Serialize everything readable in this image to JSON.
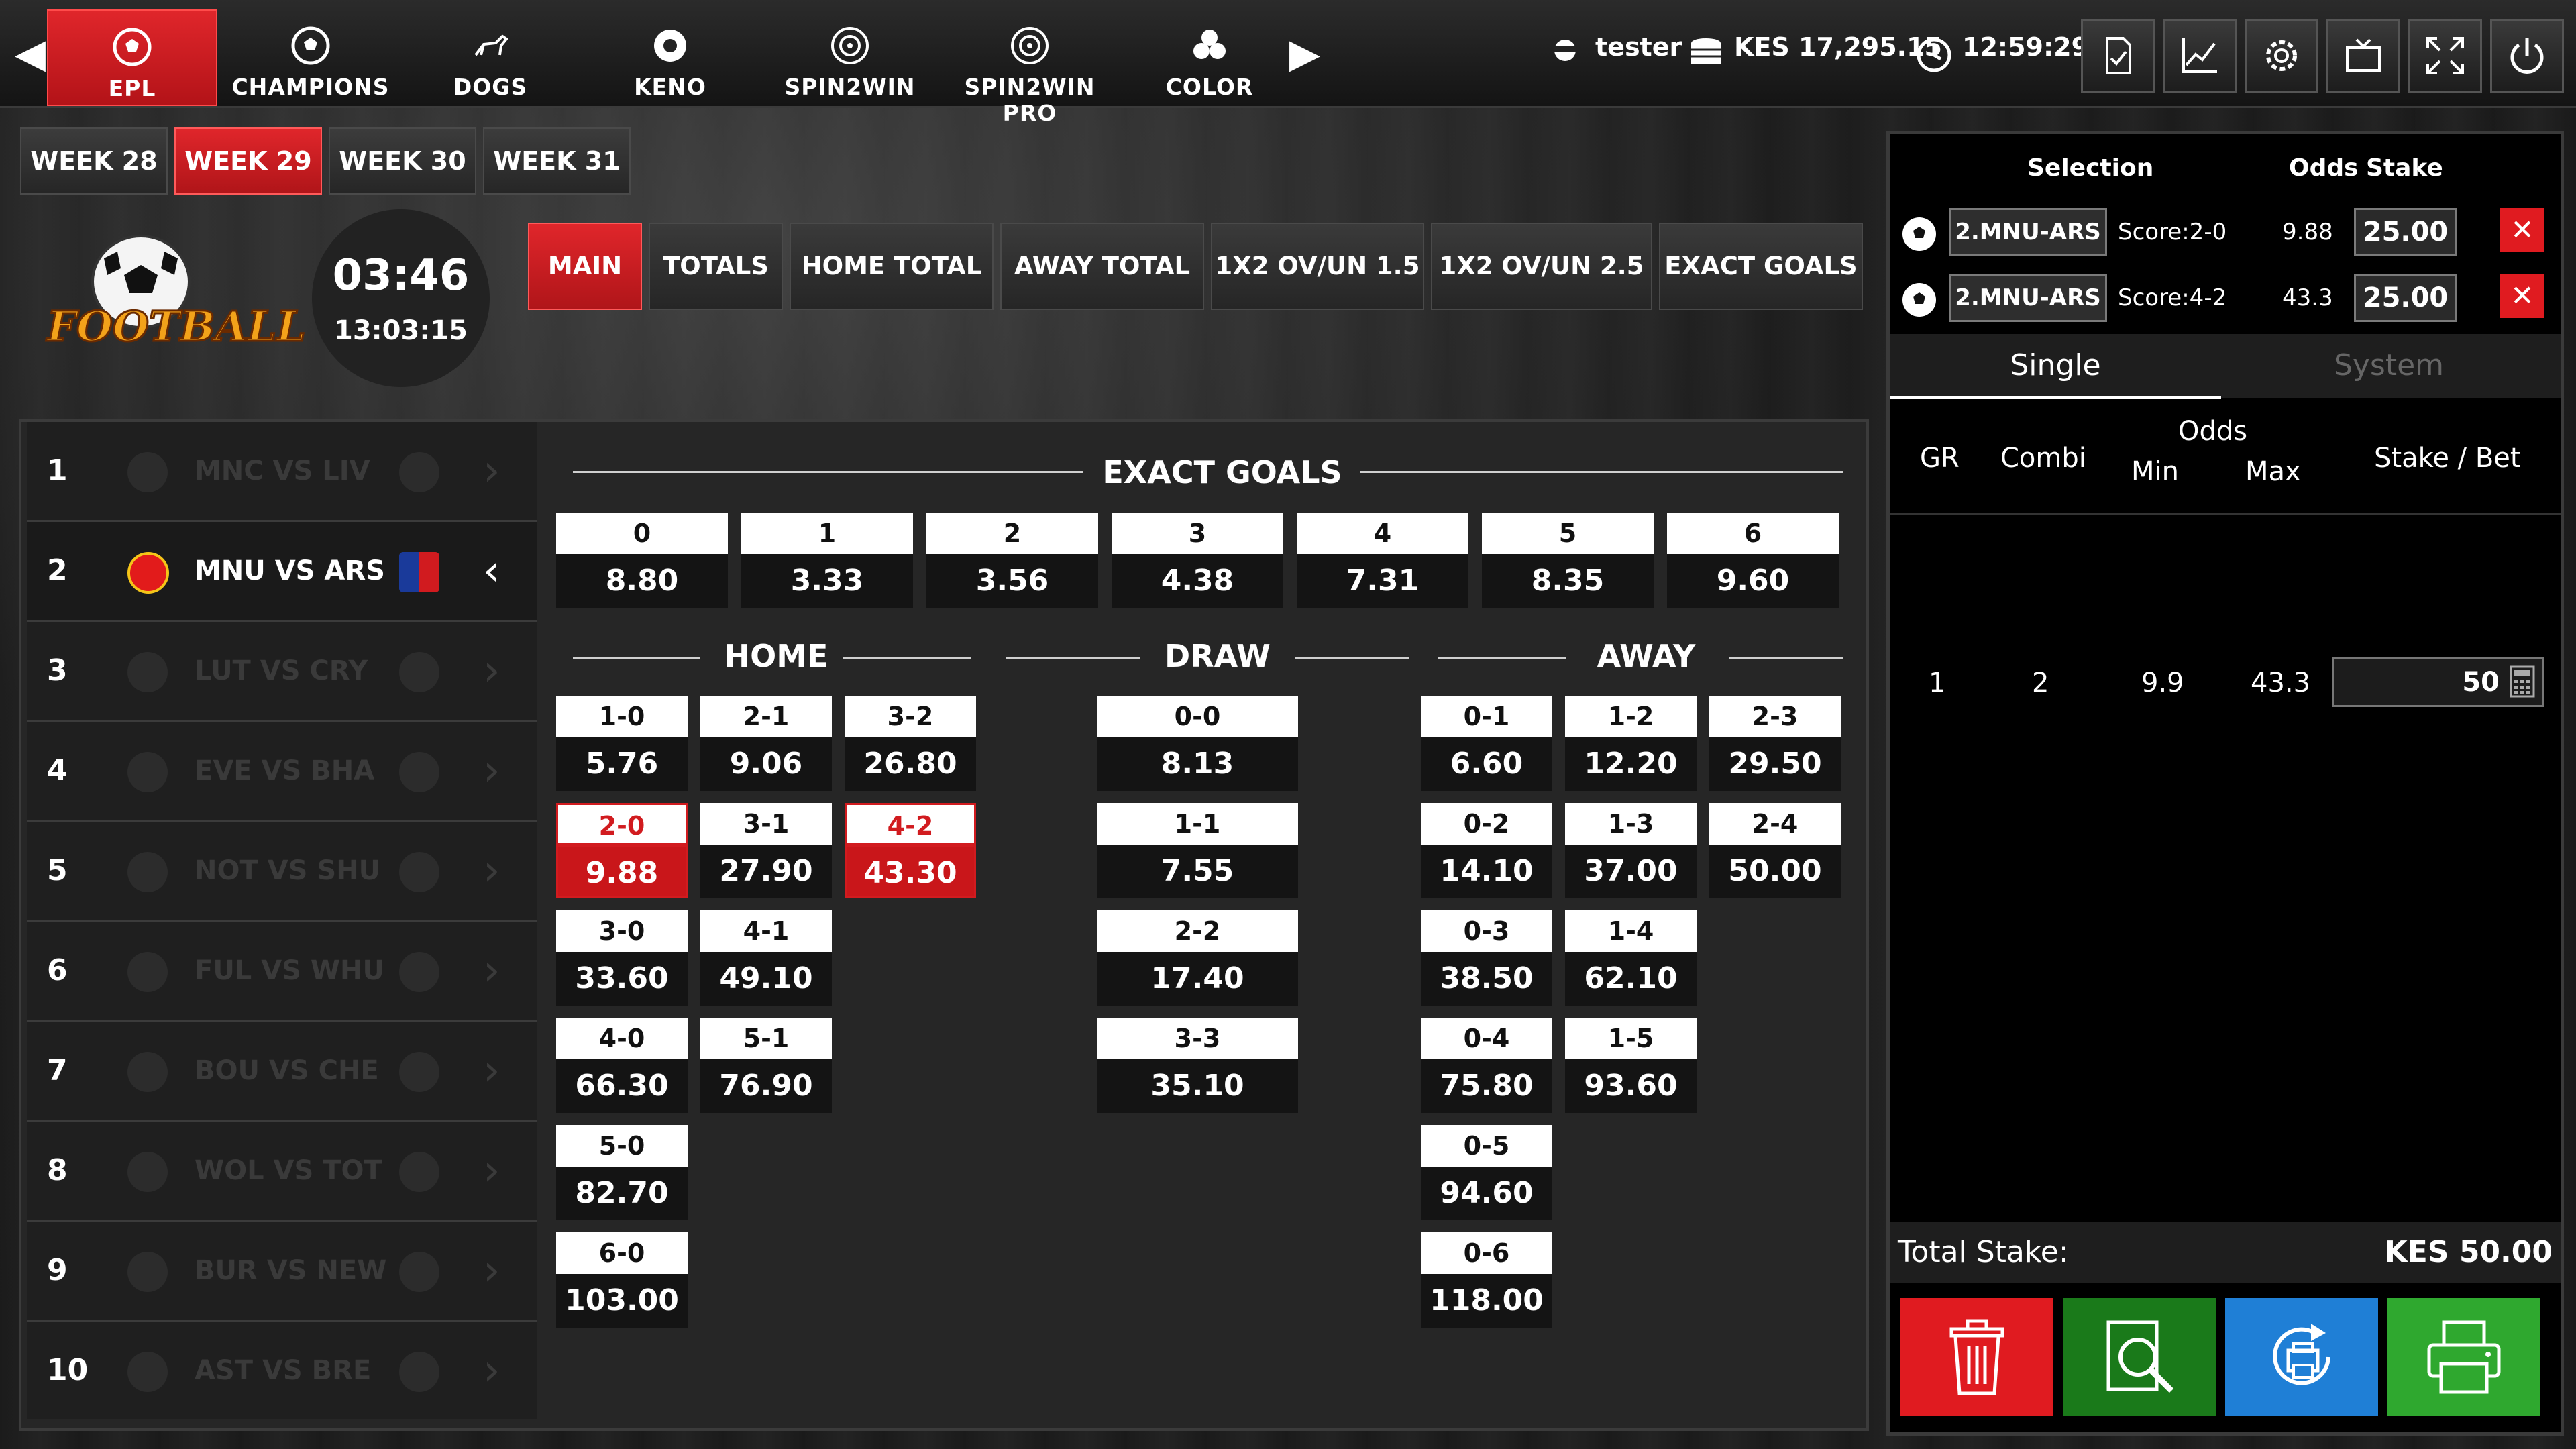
{
  "nav": {
    "tabs": [
      {
        "label": "EPL",
        "icon": "soccer-ball-icon",
        "active": true
      },
      {
        "label": "CHAMPIONS",
        "icon": "soccer-ball-icon"
      },
      {
        "label": "DOGS",
        "icon": "greyhound-icon"
      },
      {
        "label": "KENO",
        "icon": "keno-ball-icon"
      },
      {
        "label": "SPIN2WIN",
        "icon": "roulette-icon"
      },
      {
        "label": "SPIN2WIN PRO",
        "icon": "roulette-icon"
      },
      {
        "label": "COLOR",
        "icon": "color-balls-icon"
      }
    ],
    "user": "tester",
    "balance": "KES 17,295.15",
    "clock": "12:59:29",
    "buttons": [
      "ticket-check-icon",
      "stats-chart-icon",
      "settings-gear-icon",
      "tv-screen-icon",
      "fullscreen-icon",
      "power-icon"
    ]
  },
  "weeks": [
    "WEEK 28",
    "WEEK 29",
    "WEEK 30",
    "WEEK 31"
  ],
  "active_week": "WEEK 29",
  "logo_text": "FOOTBALL",
  "timer": {
    "countdown": "03:46",
    "time": "13:03:15"
  },
  "market_tabs": [
    "MAIN",
    "TOTALS",
    "HOME TOTAL",
    "AWAY TOTAL",
    "1X2 OV/UN 1.5",
    "1X2 OV/UN 2.5",
    "EXACT GOALS"
  ],
  "active_market": "MAIN",
  "matches": [
    {
      "num": "1",
      "teams": "MNC VS  LIV"
    },
    {
      "num": "2",
      "teams": "MNU VS  ARS",
      "selected": true
    },
    {
      "num": "3",
      "teams": "LUT  VS  CRY"
    },
    {
      "num": "4",
      "teams": "EVE  VS  BHA"
    },
    {
      "num": "5",
      "teams": "NOT  VS  SHU"
    },
    {
      "num": "6",
      "teams": "FUL  VS WHU"
    },
    {
      "num": "7",
      "teams": "BOU  VS  CHE"
    },
    {
      "num": "8",
      "teams": "WOL  VS  TOT"
    },
    {
      "num": "9",
      "teams": "BUR  VS  NEW"
    },
    {
      "num": "10",
      "teams": "AST  VS  BRE"
    }
  ],
  "exact_goals": {
    "title": "EXACT GOALS",
    "items": [
      {
        "k": "0",
        "v": "8.80"
      },
      {
        "k": "1",
        "v": "3.33"
      },
      {
        "k": "2",
        "v": "3.56"
      },
      {
        "k": "3",
        "v": "4.38"
      },
      {
        "k": "4",
        "v": "7.31"
      },
      {
        "k": "5",
        "v": "8.35"
      },
      {
        "k": "6",
        "v": "9.60"
      }
    ]
  },
  "scores": {
    "home_title": "HOME",
    "draw_title": "DRAW",
    "away_title": "AWAY",
    "home": [
      [
        {
          "k": "1-0",
          "v": "5.76"
        },
        {
          "k": "2-1",
          "v": "9.06"
        },
        {
          "k": "3-2",
          "v": "26.80"
        }
      ],
      [
        {
          "k": "2-0",
          "v": "9.88",
          "sel": true
        },
        {
          "k": "3-1",
          "v": "27.90"
        },
        {
          "k": "4-2",
          "v": "43.30",
          "sel": true
        }
      ],
      [
        {
          "k": "3-0",
          "v": "33.60"
        },
        {
          "k": "4-1",
          "v": "49.10"
        }
      ],
      [
        {
          "k": "4-0",
          "v": "66.30"
        },
        {
          "k": "5-1",
          "v": "76.90"
        }
      ],
      [
        {
          "k": "5-0",
          "v": "82.70"
        }
      ],
      [
        {
          "k": "6-0",
          "v": "103.00"
        }
      ]
    ],
    "draw": [
      {
        "k": "0-0",
        "v": "8.13"
      },
      {
        "k": "1-1",
        "v": "7.55"
      },
      {
        "k": "2-2",
        "v": "17.40"
      },
      {
        "k": "3-3",
        "v": "35.10"
      }
    ],
    "away": [
      [
        {
          "k": "0-1",
          "v": "6.60"
        },
        {
          "k": "1-2",
          "v": "12.20"
        },
        {
          "k": "2-3",
          "v": "29.50"
        }
      ],
      [
        {
          "k": "0-2",
          "v": "14.10"
        },
        {
          "k": "1-3",
          "v": "37.00"
        },
        {
          "k": "2-4",
          "v": "50.00"
        }
      ],
      [
        {
          "k": "0-3",
          "v": "38.50"
        },
        {
          "k": "1-4",
          "v": "62.10"
        }
      ],
      [
        {
          "k": "0-4",
          "v": "75.80"
        },
        {
          "k": "1-5",
          "v": "93.60"
        }
      ],
      [
        {
          "k": "0-5",
          "v": "94.60"
        }
      ],
      [
        {
          "k": "0-6",
          "v": "118.00"
        }
      ]
    ]
  },
  "betslip": {
    "headers": {
      "selection": "Selection",
      "odds": "Odds",
      "stake": "Stake"
    },
    "rows": [
      {
        "match": "2.MNU-ARS",
        "score": "Score:2-0",
        "odds": "9.88",
        "stake": "25.00"
      },
      {
        "match": "2.MNU-ARS",
        "score": "Score:4-2",
        "odds": "43.3",
        "stake": "25.00"
      }
    ],
    "tabs": [
      "Single",
      "System"
    ],
    "grid_headers": {
      "gr": "GR",
      "combi": "Combi",
      "odds": "Odds",
      "min": "Min",
      "max": "Max",
      "stake_bet": "Stake / Bet"
    },
    "grid_row": {
      "gr": "1",
      "combi": "2",
      "min": "9.9",
      "max": "43.3",
      "stake": "50"
    },
    "total_label": "Total Stake:",
    "total_value": "KES 50.00",
    "actions": [
      "delete-trash-icon",
      "search-ticket-icon",
      "reprint-icon",
      "print-icon"
    ],
    "colors": {
      "red": "#e01b20",
      "green": "#1a7a1a",
      "blue": "#1f7fd6",
      "lightgreen": "#2fa82f"
    }
  }
}
